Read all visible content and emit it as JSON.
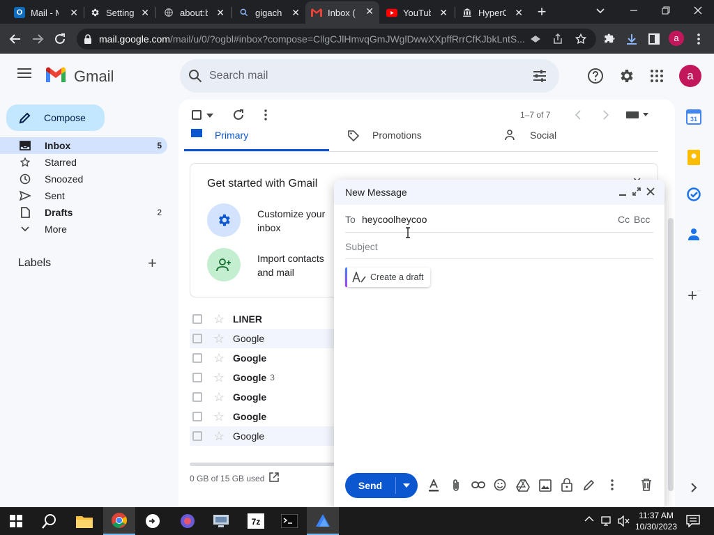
{
  "browser": {
    "tabs": [
      {
        "title": "Mail - M",
        "icon": "outlook-icon"
      },
      {
        "title": "Setting",
        "icon": "gear-icon"
      },
      {
        "title": "about:b",
        "icon": "globe-icon"
      },
      {
        "title": "gigach",
        "icon": "search-icon"
      },
      {
        "title": "Inbox (",
        "icon": "gmail-icon",
        "active": true
      },
      {
        "title": "YouTub",
        "icon": "youtube-icon"
      },
      {
        "title": "HyperC",
        "icon": "museum-icon"
      }
    ],
    "url_host": "mail.google.com",
    "url_rest": "/mail/u/0/?ogbl#inbox?compose=CllgCJlHmvqGmJWglDwwXXpffRrrCfKJbkLntS...",
    "profile_initial": "a"
  },
  "gmail": {
    "logo_text": "Gmail",
    "search_placeholder": "Search mail",
    "compose_label": "Compose",
    "account_initial": "a",
    "nav": [
      {
        "label": "Inbox",
        "count": "5",
        "icon": "inbox-icon",
        "active": true
      },
      {
        "label": "Starred",
        "count": "",
        "icon": "star-icon"
      },
      {
        "label": "Snoozed",
        "count": "",
        "icon": "clock-icon"
      },
      {
        "label": "Sent",
        "count": "",
        "icon": "send-icon"
      },
      {
        "label": "Drafts",
        "count": "2",
        "icon": "draft-icon"
      },
      {
        "label": "More",
        "count": "",
        "icon": "chevron-down-icon"
      }
    ],
    "labels_heading": "Labels",
    "pagination": "1–7 of 7",
    "category_tabs": [
      "Primary",
      "Promotions",
      "Social"
    ],
    "get_started": {
      "title": "Get started with Gmail",
      "items": [
        "Customize your inbox",
        "Import contacts and mail"
      ]
    },
    "emails": [
      {
        "sender": "LINER",
        "count": "",
        "unread": true
      },
      {
        "sender": "Google",
        "count": "",
        "unread": false
      },
      {
        "sender": "Google",
        "count": "",
        "unread": true
      },
      {
        "sender": "Google",
        "count": "3",
        "unread": true
      },
      {
        "sender": "Google",
        "count": "",
        "unread": true
      },
      {
        "sender": "Google",
        "count": "",
        "unread": true
      },
      {
        "sender": "Google",
        "count": "",
        "unread": false
      }
    ],
    "storage": "0 GB of 15 GB used"
  },
  "compose": {
    "title": "New Message",
    "to_label": "To",
    "to_value": "heycoolheycoo",
    "cc_bcc": "Cc Bcc",
    "subject_placeholder": "Subject",
    "create_draft": "Create a draft",
    "send_label": "Send"
  },
  "taskbar": {
    "time": "11:37 AM",
    "date": "10/30/2023"
  },
  "colors": {
    "gmail_blue": "#0b57d0",
    "compose_bg": "#c2e7ff",
    "nav_active": "#d3e3fd",
    "avatar": "#c2185b"
  }
}
